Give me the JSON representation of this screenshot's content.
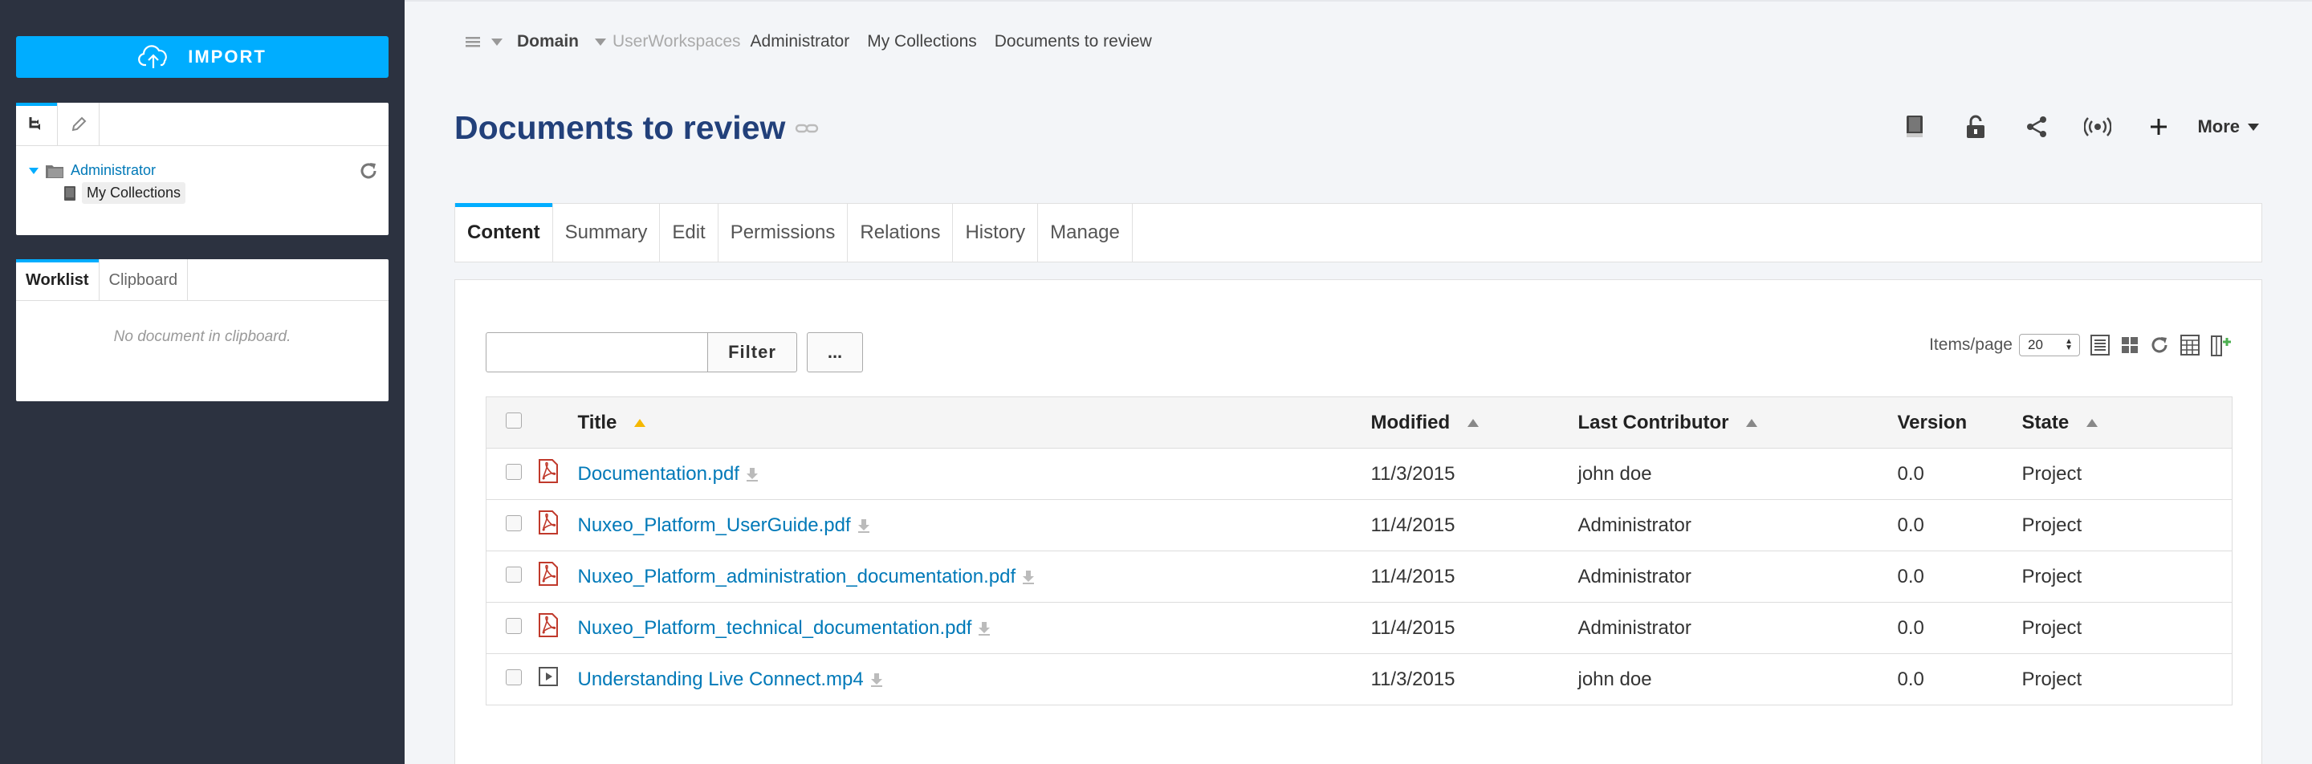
{
  "sidebar": {
    "import_label": "IMPORT",
    "tree": {
      "root_label": "Administrator",
      "child_label": "My Collections"
    },
    "worklist": {
      "tabs": [
        "Worklist",
        "Clipboard"
      ],
      "empty_message": "No document in clipboard."
    }
  },
  "breadcrumb": {
    "domain": "Domain",
    "workspaces": "UserWorkspaces",
    "items": [
      "Administrator",
      "My Collections",
      "Documents to review"
    ]
  },
  "page": {
    "title": "Documents to review"
  },
  "actions": {
    "more_label": "More"
  },
  "tabs": [
    "Content",
    "Summary",
    "Edit",
    "Permissions",
    "Relations",
    "History",
    "Manage"
  ],
  "filter": {
    "value": "",
    "button_label": "Filter",
    "more_label": "..."
  },
  "pagination": {
    "items_label": "Items/page",
    "items_value": "20"
  },
  "table": {
    "columns": [
      "Title",
      "Modified",
      "Last Contributor",
      "Version",
      "State"
    ],
    "rows": [
      {
        "title": "Documentation.pdf",
        "modified": "11/3/2015",
        "contributor": "john doe",
        "version": "0.0",
        "state": "Project",
        "type": "pdf"
      },
      {
        "title": "Nuxeo_Platform_UserGuide.pdf",
        "modified": "11/4/2015",
        "contributor": "Administrator",
        "version": "0.0",
        "state": "Project",
        "type": "pdf"
      },
      {
        "title": "Nuxeo_Platform_administration_documentation.pdf",
        "modified": "11/4/2015",
        "contributor": "Administrator",
        "version": "0.0",
        "state": "Project",
        "type": "pdf"
      },
      {
        "title": "Nuxeo_Platform_technical_documentation.pdf",
        "modified": "11/4/2015",
        "contributor": "Administrator",
        "version": "0.0",
        "state": "Project",
        "type": "pdf"
      },
      {
        "title": "Understanding Live Connect.mp4",
        "modified": "11/3/2015",
        "contributor": "john doe",
        "version": "0.0",
        "state": "Project",
        "type": "video"
      }
    ]
  },
  "colors": {
    "accent": "#00adff",
    "sidebar_bg": "#2c3240",
    "title": "#22407a",
    "link": "#0079b8"
  }
}
